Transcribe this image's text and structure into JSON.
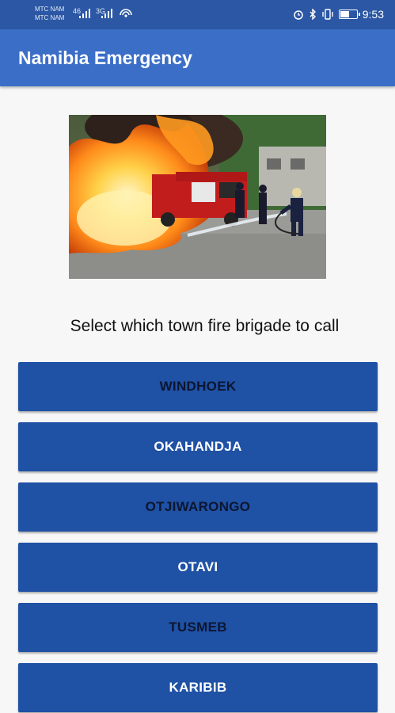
{
  "status_bar": {
    "carrier_1": "MTC NAM",
    "carrier_2": "MTC NAM",
    "net_1": "46",
    "net_2": "3G",
    "time": "9:53"
  },
  "app_bar": {
    "title": "Namibia Emergency"
  },
  "prompt": "Select which town fire brigade to call",
  "towns": [
    {
      "label": "WINDHOEK"
    },
    {
      "label": "OKAHANDJA"
    },
    {
      "label": "OTJIWARONGO"
    },
    {
      "label": "OTAVI"
    },
    {
      "label": "TUSMEB"
    },
    {
      "label": "KARIBIB"
    }
  ],
  "colors": {
    "status_bar": "#2b57a4",
    "app_bar": "#3b6ec7",
    "button": "#1f51a5",
    "background": "#f7f7f7"
  }
}
